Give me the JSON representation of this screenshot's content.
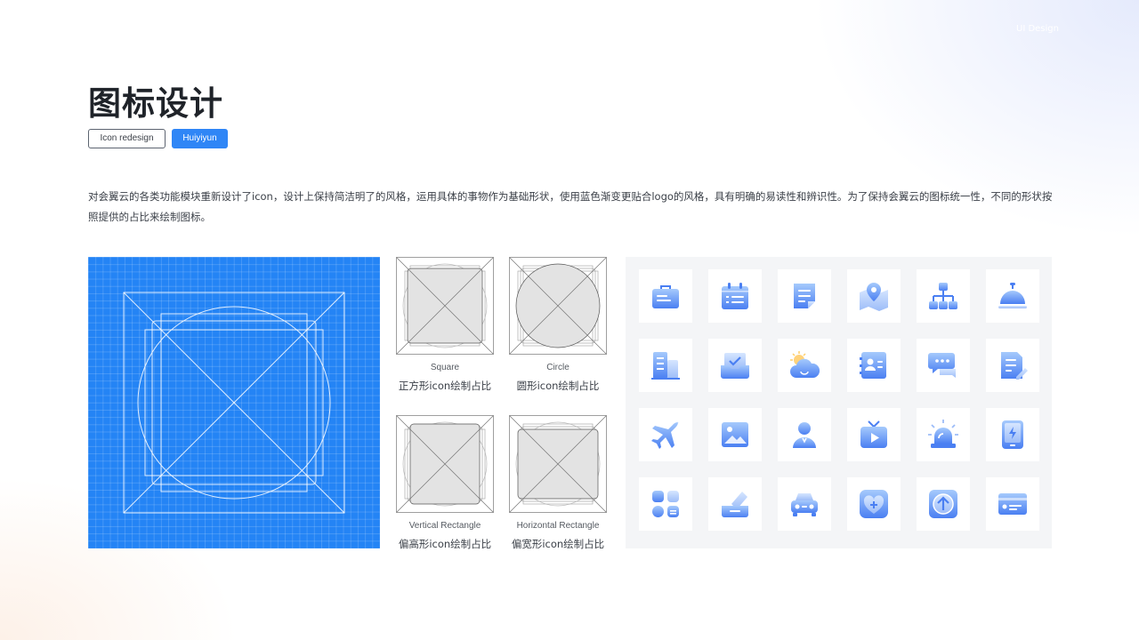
{
  "header": {
    "corner_note": "UI Design",
    "title": "图标设计",
    "tags": [
      "Icon redesign",
      "Huiyiyun"
    ]
  },
  "description": "对会翼云的各类功能模块重新设计了icon，设计上保持简洁明了的风格，运用具体的事物作为基础形状，使用蓝色渐变更贴合logo的风格，具有明确的易读性和辨识性。为了保持会翼云的图标统一性，不同的形状按照提供的占比来绘制图标。",
  "templates": [
    {
      "en": "Square",
      "cn": "正方形icon绘制占比"
    },
    {
      "en": "Circle",
      "cn": "圆形icon绘制占比"
    },
    {
      "en": "Vertical Rectangle",
      "cn": "偏高形icon绘制占比"
    },
    {
      "en": "Horizontal Rectangle",
      "cn": "偏宽形icon绘制占比"
    }
  ],
  "colors": {
    "accent": "#2f86f6",
    "grid_blue": "#2484f5",
    "icon_gradient_light": "#9fc4fb",
    "icon_gradient_dark": "#4a82f2",
    "panel_gray": "#f4f5f7",
    "text_dark": "#1f2329"
  },
  "icons": [
    "briefcase-icon",
    "calendar-icon",
    "document-icon",
    "map-pin-icon",
    "org-chart-icon",
    "service-bell-icon",
    "building-icon",
    "inbox-tray-icon",
    "weather-cloud-icon",
    "contact-card-icon",
    "chat-bubbles-icon",
    "edit-document-icon",
    "airplane-icon",
    "picture-icon",
    "user-icon",
    "tv-play-icon",
    "alarm-light-icon",
    "tablet-charge-icon",
    "apps-grid-icon",
    "eraser-icon",
    "car-icon",
    "heart-plus-icon",
    "upload-icon",
    "id-card-icon"
  ]
}
